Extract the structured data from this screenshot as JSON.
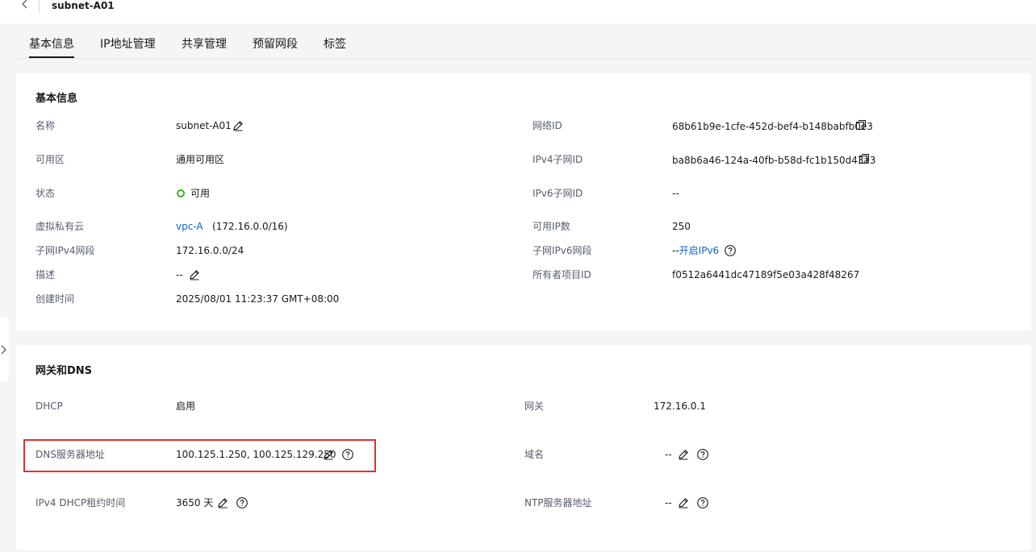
{
  "header": {
    "title": "subnet-A01",
    "back_icon": "chevron-left-icon"
  },
  "tabs": [
    {
      "label": "基本信息",
      "active": true
    },
    {
      "label": "IP地址管理",
      "active": false
    },
    {
      "label": "共享管理",
      "active": false
    },
    {
      "label": "预留网段",
      "active": false
    },
    {
      "label": "标签",
      "active": false
    }
  ],
  "basic": {
    "title": "基本信息",
    "name": {
      "label": "名称",
      "value": "subnet-A01"
    },
    "az": {
      "label": "可用区",
      "value": "通用可用区"
    },
    "status": {
      "label": "状态",
      "value": "可用",
      "color": "#3cb31b"
    },
    "vpc": {
      "label": "虚拟私有云",
      "link": "vpc-A",
      "cidr": "(172.16.0.0/16)"
    },
    "ipv4_cidr": {
      "label": "子网IPv4网段",
      "value": "172.16.0.0/24"
    },
    "desc": {
      "label": "描述",
      "value": "--"
    },
    "created": {
      "label": "创建时间",
      "value": "2025/08/01 11:23:37 GMT+08:00"
    },
    "network_id": {
      "label": "网络ID",
      "value": "68b61b9e-1cfe-452d-bef4-b148babfb0e3"
    },
    "ipv4_subnet_id": {
      "label": "IPv4子网ID",
      "value": "ba8b6a46-124a-40fb-b58d-fc1b150d43a3"
    },
    "ipv6_subnet_id": {
      "label": "IPv6子网ID",
      "value": "--"
    },
    "available_ips": {
      "label": "可用IP数",
      "value": "250"
    },
    "ipv6_cidr": {
      "label": "子网IPv6网段",
      "prefix": "--",
      "link": "开启IPv6"
    },
    "owner_project": {
      "label": "所有者项目ID",
      "value": "f0512a6441dc47189f5e03a428f48267"
    }
  },
  "gateway": {
    "title": "网关和DNS",
    "dhcp": {
      "label": "DHCP",
      "value": "启用"
    },
    "dns": {
      "label": "DNS服务器地址",
      "value": "100.125.1.250, 100.125.129.250"
    },
    "lease": {
      "label": "IPv4 DHCP租约时间",
      "value": "3650 天"
    },
    "gw": {
      "label": "网关",
      "value": "172.16.0.1"
    },
    "domain": {
      "label": "域名",
      "value": "--"
    },
    "ntp": {
      "label": "NTP服务器地址",
      "value": "--"
    }
  },
  "colors": {
    "accent": "#0e62d6",
    "highlight": "#e03131",
    "status_ok": "#3cb31b"
  }
}
